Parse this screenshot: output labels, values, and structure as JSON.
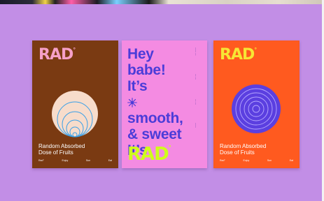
{
  "posters": {
    "left": {
      "logo": "RAD",
      "caption_line1": "Random Absorbed",
      "caption_line2": "Dose of Fruits",
      "footer": [
        "Rad°",
        "Enjoy",
        "Sun",
        "Eat"
      ],
      "colors": {
        "background": "#7a3a12",
        "logo": "#f6a0c8",
        "circle": "#f7dccb",
        "rings": "#3aa0e8"
      }
    },
    "center": {
      "headline": [
        "Hey",
        "babe!",
        "It’s",
        "smooth,",
        "& sweet",
        "It’s"
      ],
      "logo": "RAD",
      "colors": {
        "background": "#f48be2",
        "text": "#4b3cd8",
        "logo": "#cfff1a"
      }
    },
    "right": {
      "logo": "RAD",
      "caption_line1": "Random Absorbed",
      "caption_line2": "Dose of Fruits",
      "footer": [
        "Rad°",
        "Enjoy",
        "Sun",
        "Eat"
      ],
      "colors": {
        "background": "#ff5a1f",
        "logo": "#f7e634",
        "circle": "#5b3fe0",
        "rings": "#b8a8ff"
      }
    }
  },
  "backdrop_color": "#c28ee6"
}
